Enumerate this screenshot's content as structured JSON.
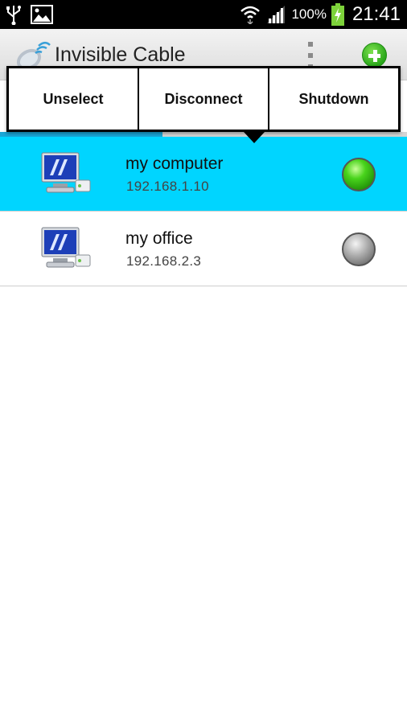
{
  "status_bar": {
    "icons": [
      "usb-icon",
      "image-notification-icon",
      "wifi-icon",
      "signal-icon",
      "battery-charging-icon"
    ],
    "battery": "100%",
    "time": "21:41"
  },
  "action_bar": {
    "title": "Invisible Cable",
    "icons": [
      "satellite-logo-icon",
      "overflow-menu-icon",
      "add-icon"
    ]
  },
  "popup": {
    "actions": [
      {
        "label": "Unselect"
      },
      {
        "label": "Disconnect"
      },
      {
        "label": "Shutdown"
      }
    ]
  },
  "devices": [
    {
      "name": "my computer",
      "ip": "192.168.1.10",
      "status": "connected",
      "selected": true,
      "status_color": "#3fcf12"
    },
    {
      "name": "my office",
      "ip": "192.168.2.3",
      "status": "disconnected",
      "selected": false,
      "status_color": "#9a9a9a"
    }
  ],
  "colors": {
    "selected_row": "#00d5ff",
    "tab_indicator": "#1aa6d6"
  }
}
